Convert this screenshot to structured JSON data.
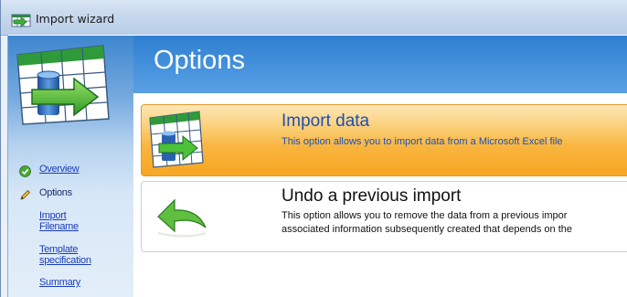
{
  "window": {
    "title": "Import wizard"
  },
  "header": {
    "title": "Options"
  },
  "steps": [
    {
      "label": "Overview",
      "icon": "check-circle-icon",
      "current": false
    },
    {
      "label": "Options",
      "icon": "pencil-icon",
      "current": true
    },
    {
      "label": "Import Filename",
      "icon": "",
      "current": false
    },
    {
      "label": "Template specification",
      "icon": "",
      "current": false
    },
    {
      "label": "Summary",
      "icon": "",
      "current": false
    }
  ],
  "options": [
    {
      "title": "Import data",
      "description": "This option allows you to import data from a Microsoft Excel file",
      "icon": "import-spreadsheet-icon",
      "selected": true
    },
    {
      "title": "Undo a previous import",
      "description_line1": "This option allows you to remove the data from a previous impor",
      "description_line2": "associated information subsequently created that depends on the",
      "icon": "undo-arrow-icon",
      "selected": false
    }
  ],
  "colors": {
    "header_blue": "#3c8ad7",
    "selected_orange": "#f8b53e",
    "link_blue": "#1a3dbd"
  }
}
